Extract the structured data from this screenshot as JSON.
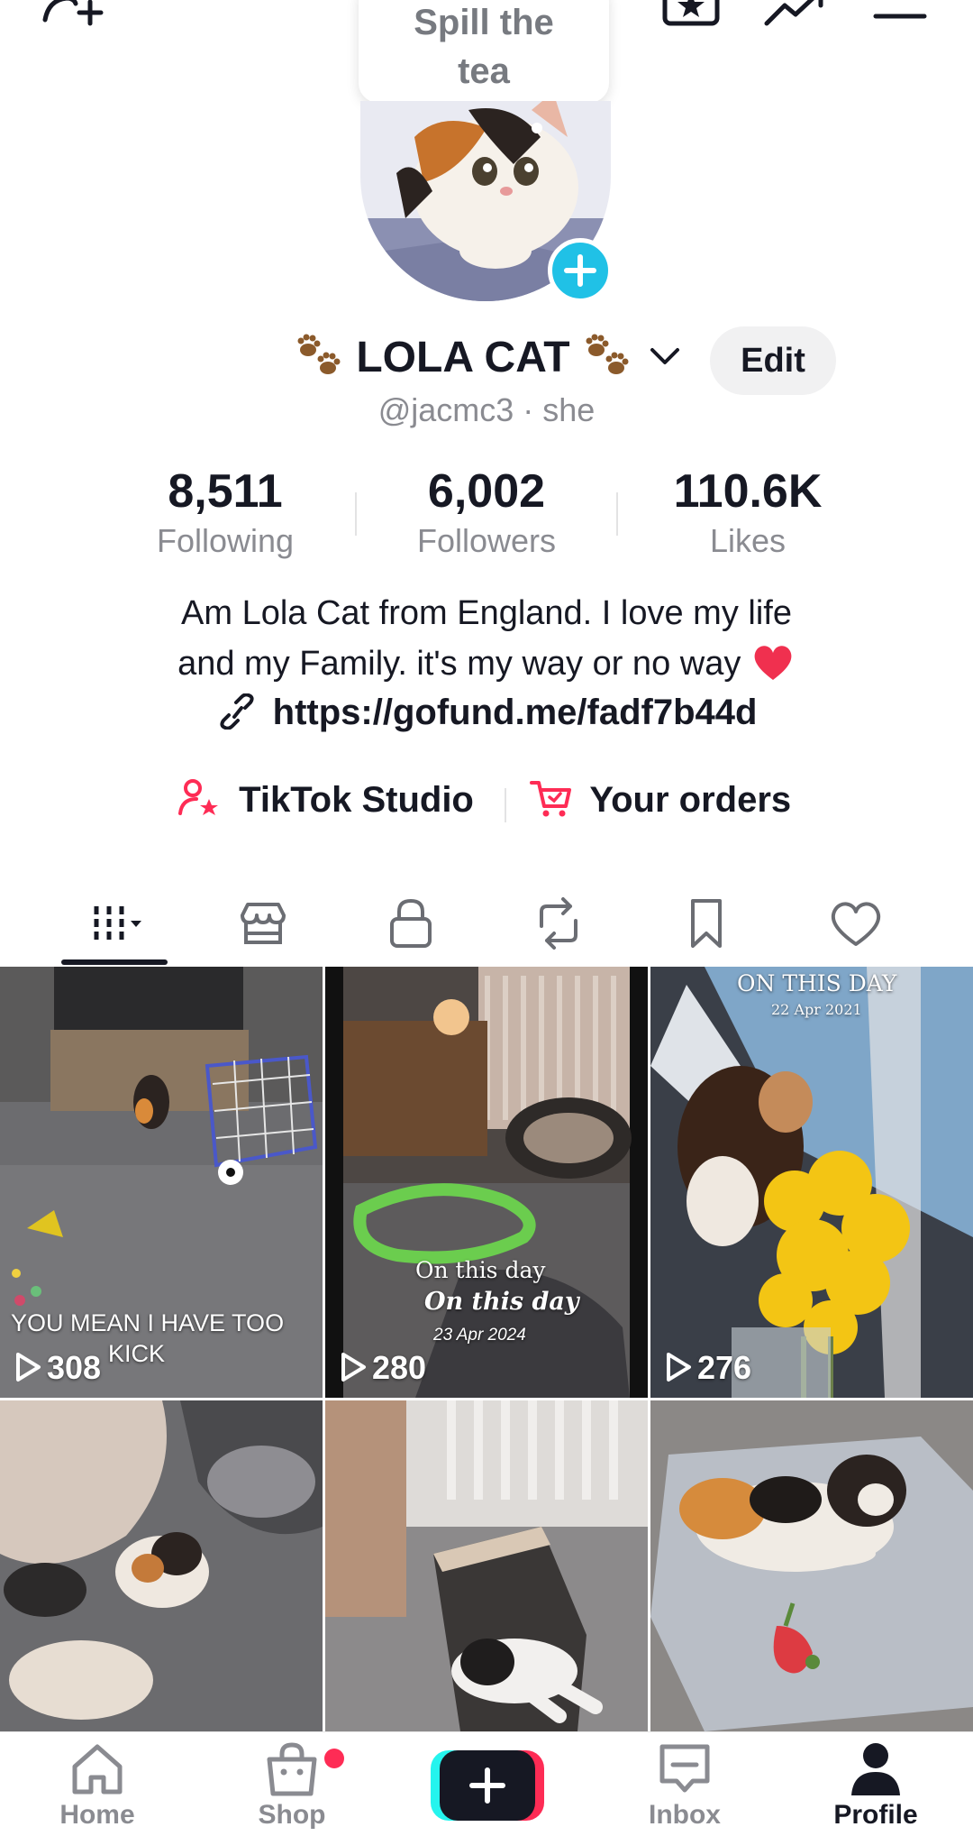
{
  "popup": {
    "text_line1": "Spill the",
    "text_line2": "tea"
  },
  "profile": {
    "display_name": "LOLA CAT",
    "edit_label": "Edit",
    "handle": "@jacmc3 · she",
    "stats": [
      {
        "value": "8,511",
        "label": "Following"
      },
      {
        "value": "6,002",
        "label": "Followers"
      },
      {
        "value": "110.6K",
        "label": "Likes"
      }
    ],
    "bio_line1": "Am Lola Cat from England. I love my life",
    "bio_line2": "and my Family. it's my way or no way",
    "link": "https://gofund.me/fadf7b44d"
  },
  "shortcuts": {
    "studio": "TikTok Studio",
    "orders": "Your orders"
  },
  "tabs": [
    "videos-grid-icon",
    "shop-icon",
    "lock-icon",
    "repost-icon",
    "bookmark-icon",
    "heart-icon"
  ],
  "videos": [
    {
      "views": "308",
      "caption": "YOU MEAN I HAVE TOO",
      "caption2": "KICK"
    },
    {
      "views": "280",
      "caption": "On this day",
      "caption2": "On this day",
      "caption3": "23 Apr 2024"
    },
    {
      "views": "276",
      "caption": "ON THIS DAY",
      "caption2": "22 Apr 2021"
    },
    {
      "views": ""
    },
    {
      "views": ""
    },
    {
      "views": ""
    }
  ],
  "nav": {
    "home": "Home",
    "shop": "Shop",
    "inbox": "Inbox",
    "profile": "Profile"
  },
  "colors": {
    "accent": "#fe2c55",
    "cyan": "#20c1e6",
    "text": "#161823",
    "muted": "#8a8b91"
  }
}
